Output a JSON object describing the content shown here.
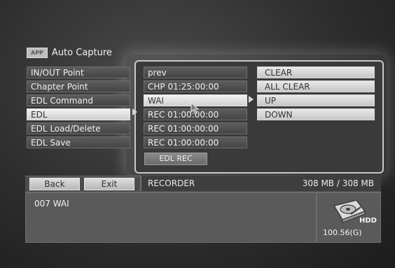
{
  "header": {
    "app_tag": "APP",
    "title": "Auto Capture"
  },
  "menu_left": [
    "IN/OUT Point",
    "Chapter Point",
    "EDL Command",
    "EDL",
    "EDL Load/Delete",
    "EDL Save"
  ],
  "menu_middle": [
    "prev",
    "CHP 01:25:00:00",
    "WAI",
    "REC 01:00:00:00",
    "REC 01:00:00:00",
    "REC 01:00:00:00"
  ],
  "edl_rec_button": "EDL REC",
  "menu_right": [
    "CLEAR",
    "ALL CLEAR",
    "UP",
    "DOWN"
  ],
  "bottom": {
    "back": "Back",
    "exit": "Exit",
    "mode": "RECORDER",
    "capacity": "308 MB / 308 MB"
  },
  "info": {
    "text": "007  WAI"
  },
  "hdd": {
    "label": "HDD",
    "size": "100.56(G)"
  }
}
